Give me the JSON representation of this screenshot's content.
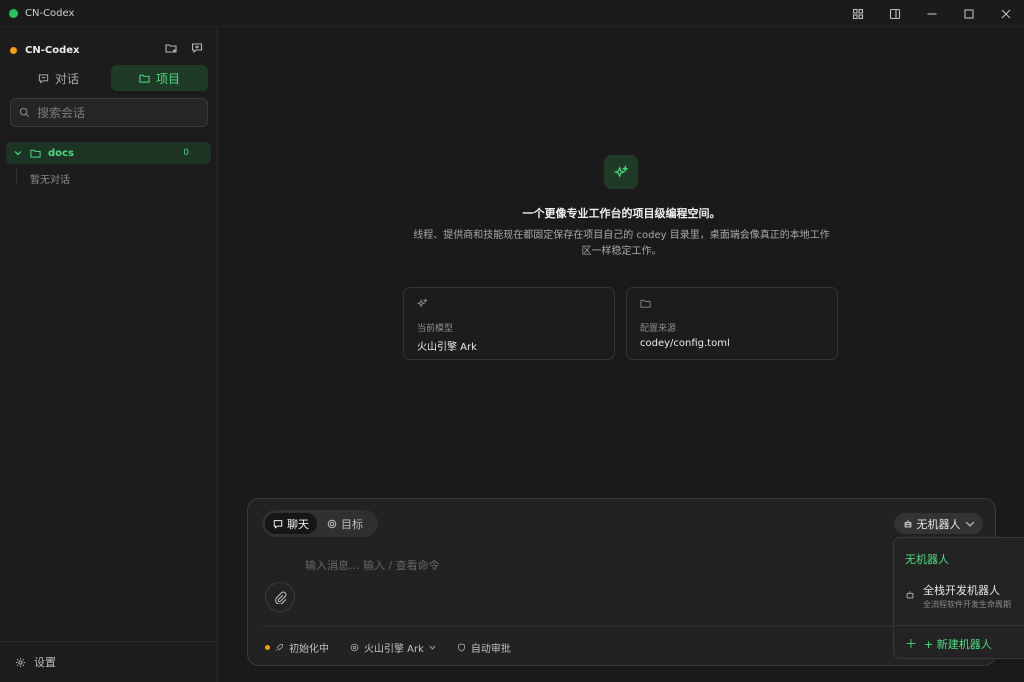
{
  "window": {
    "title": "CN-Codex"
  },
  "sidebar": {
    "workspace_name": "CN-Codex",
    "tabs": [
      {
        "label": "对话",
        "icon": "chat-icon",
        "active": false
      },
      {
        "label": "项目",
        "icon": "folder-icon",
        "active": true
      }
    ],
    "search": {
      "placeholder": "搜索会话"
    },
    "project": {
      "name": "docs",
      "count": "0",
      "empty_label": "暂无对话"
    },
    "settings_label": "设置"
  },
  "main": {
    "hero": {
      "icon": "sparkles-icon",
      "title": "一个更像专业工作台的项目级编程空间。",
      "description": "线程、提供商和技能现在都固定保存在项目自己的 codey 目录里，桌面端会像真正的本地工作区一样稳定工作。"
    },
    "cards": [
      {
        "icon": "sparkles-icon",
        "label": "当前模型",
        "value": "火山引擎 Ark"
      },
      {
        "icon": "folder-icon",
        "label": "配置来源",
        "value": "codey/config.toml"
      }
    ]
  },
  "composer": {
    "modes": [
      {
        "label": "聊天",
        "active": true
      },
      {
        "label": "目标",
        "active": false
      }
    ],
    "input_placeholder": "输入消息... 输入 / 查看命令",
    "robot_selector": "无机器人",
    "status": {
      "init_label": "初始化中",
      "model_label": "火山引擎 Ark",
      "auto_approve_label": "自动审批"
    }
  },
  "robot_dropdown": {
    "none_label": "无机器人",
    "items": [
      {
        "name": "全栈开发机器人",
        "description": "全流程软件开发生命周期"
      }
    ],
    "new_label": "+ 新建机器人"
  },
  "colors": {
    "accent": "#4ade80",
    "accent_bg": "#1f3a27",
    "status_orange": "#f59e0b",
    "background": "#191919"
  }
}
